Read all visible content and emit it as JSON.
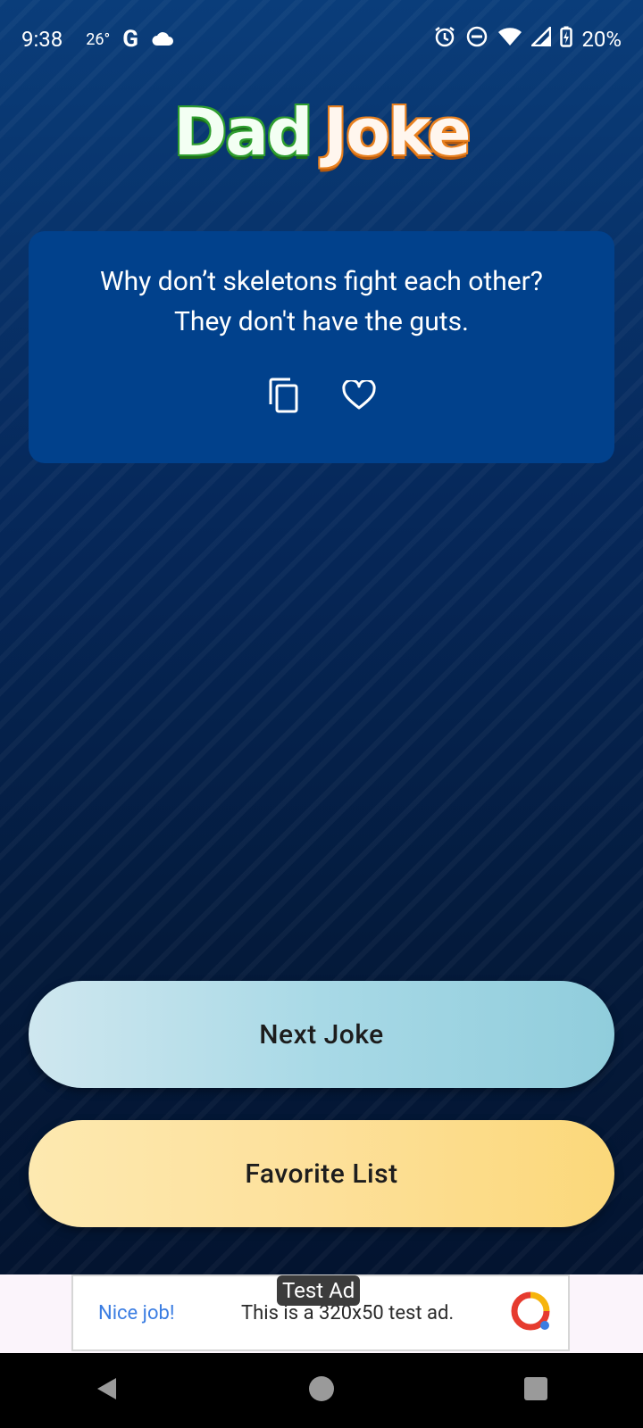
{
  "status_bar": {
    "time": "9:38",
    "temperature": "26°",
    "google_label": "G",
    "battery": "20%",
    "icons": [
      "cloud-icon",
      "alarm-icon",
      "do-not-disturb-icon",
      "wifi-icon",
      "signal-icon",
      "battery-charging-icon"
    ]
  },
  "header": {
    "logo_word1": "Dad",
    "logo_word2": "Joke"
  },
  "joke_card": {
    "setup": "Why don’t skeletons fight each other?",
    "punchline": "They don't have the guts.",
    "copy_icon": "copy-icon",
    "favorite_icon": "heart-outline-icon"
  },
  "buttons": {
    "next_label": "Next Joke",
    "favorites_label": "Favorite List"
  },
  "ad": {
    "badge": "Test Ad",
    "headline": "Nice job!",
    "description": "This is a 320x50 test ad."
  },
  "nav_bar": {
    "icons": [
      "back-icon",
      "home-icon",
      "recents-icon"
    ]
  },
  "colors": {
    "background": "#06214a",
    "card": "#01418c",
    "next_button": "#a8d9e6",
    "favorite_button": "#fde09a",
    "logo_green": "#2f9e2f",
    "logo_orange": "#e8801f"
  }
}
